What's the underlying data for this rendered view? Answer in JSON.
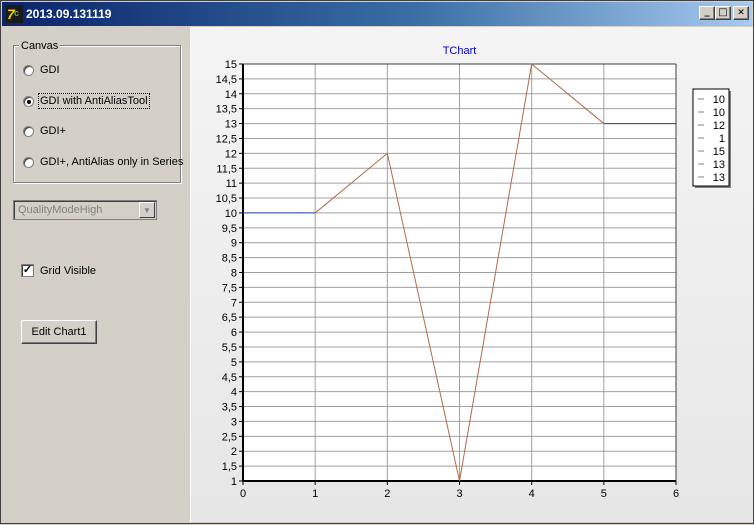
{
  "window": {
    "title": "2013.09.131119",
    "min_glyph": "_",
    "max_glyph": "□",
    "close_glyph": "✕"
  },
  "canvas_group": {
    "title": "Canvas",
    "options": [
      {
        "label": "GDI",
        "selected": false
      },
      {
        "label": "GDI with AntiAliasTool",
        "selected": true
      },
      {
        "label": "GDI+",
        "selected": false
      },
      {
        "label": "GDI+, AntiAlias only in Series",
        "selected": false
      }
    ]
  },
  "quality_combo": {
    "value": "QualityModeHigh",
    "arrow": "▼"
  },
  "grid_checkbox": {
    "label": "Grid Visible",
    "checked": true,
    "mark": "✓"
  },
  "edit_button": {
    "label": "Edit Chart1"
  },
  "chart_data": {
    "type": "line",
    "title": "TChart",
    "x": [
      0,
      1,
      2,
      3,
      4,
      5,
      6
    ],
    "series": [
      {
        "values": [
          10,
          10,
          12,
          1,
          15,
          13,
          13
        ],
        "colors": [
          "#1f4ea8",
          "#b06a4a",
          "#b06a4a",
          "#b06a4a",
          "#b06a4a",
          "#1f4ea8"
        ]
      }
    ],
    "xlim": [
      0,
      6
    ],
    "ylim": [
      1,
      15
    ],
    "x_ticks": [
      "0",
      "1",
      "2",
      "3",
      "4",
      "5",
      "6"
    ],
    "y_ticks": [
      "1",
      "1,5",
      "2",
      "2,5",
      "3",
      "3,5",
      "4",
      "4,5",
      "5",
      "5,5",
      "6",
      "6,5",
      "7",
      "7,5",
      "8",
      "8,5",
      "9",
      "9,5",
      "10",
      "10,5",
      "11",
      "11,5",
      "12",
      "12,5",
      "13",
      "13,5",
      "14",
      "14,5",
      "15"
    ],
    "grid": true,
    "legend_position": "right",
    "legend": [
      "10",
      "10",
      "12",
      "1",
      "15",
      "13",
      "13"
    ],
    "colors": {
      "title": "#0000cc",
      "grid": "#a0a0a0"
    }
  }
}
